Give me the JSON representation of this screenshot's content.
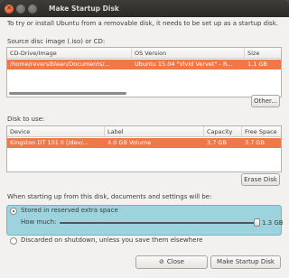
{
  "window": {
    "title": "Make Startup Disk"
  },
  "intro_text": "To try or install Ubuntu from a removable disk, it needs to be set up as a startup disk.",
  "source": {
    "section_label": "Source disc image (.iso) or CD:",
    "columns": [
      "CD-Drive/Image",
      "OS Version",
      "Size"
    ],
    "rows": [
      {
        "image": "/home/reversiblean/Documents/...",
        "os_version": "Ubuntu 15.04 \"Vivid Vervet\" - R...",
        "size": "1.1 GB",
        "selected": true
      }
    ],
    "other_button": "Other..."
  },
  "disk": {
    "section_label": "Disk to use:",
    "columns": [
      "Device",
      "Label",
      "Capacity",
      "Free Space"
    ],
    "rows": [
      {
        "device": "Kingston DT 101 II (/dev/...",
        "label": "4.0 GB Volume",
        "capacity": "3.7 GB",
        "free_space": "3.7 GB",
        "selected": true
      }
    ],
    "erase_button": "Erase Disk"
  },
  "startup": {
    "label": "When starting up from this disk, documents and settings will be:",
    "option_reserved": "Stored in reserved extra space",
    "option_discard": "Discarded on shutdown, unless you save them elsewhere",
    "selected_option": "reserved",
    "how_much_label": "How much:",
    "reserved_amount": "1.3 GB",
    "reserved_fraction": 0.99
  },
  "buttons": {
    "close": "Close",
    "make": "Make Startup Disk"
  },
  "colors": {
    "selection": "#f07746",
    "reserve_highlight": "#9cd3dc",
    "titlebar": "#2b2a27"
  }
}
